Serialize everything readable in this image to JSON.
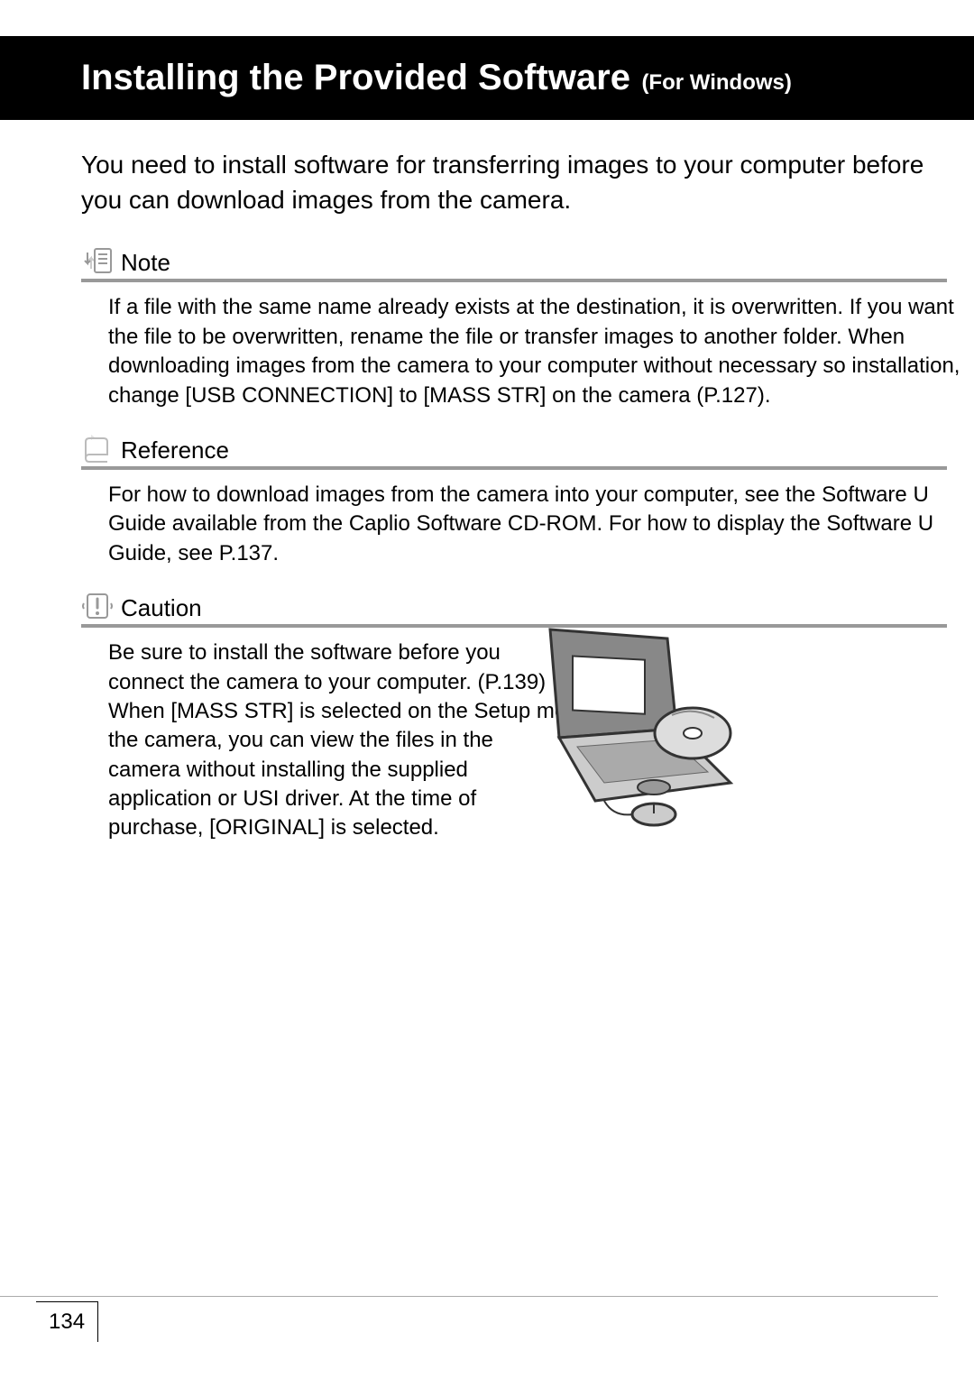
{
  "title": {
    "main": "Installing the Provided Software",
    "sub": "(For Windows)"
  },
  "intro": "You need to install software for transferring images to your computer before you can download images from the camera.",
  "note": {
    "label": "Note",
    "body": "If a file with the same name already exists at the destination, it is overwritten. If you want the file to be overwritten, rename the file or transfer images to another folder. When downloading images from the camera to your computer without necessary so installation, change [USB CONNECTION] to [MASS STR] on the camera (P.127)."
  },
  "reference": {
    "label": "Reference",
    "body": "For how to download images from the camera into your computer, see the Software U Guide available from the Caplio Software CD-ROM. For how to display the Software U Guide, see P.137."
  },
  "caution": {
    "label": "Caution",
    "body": "Be sure to install the software before you connect the camera to your computer. (P.139)\nWhen [MASS STR] is selected on the Setup me the camera, you can view the files in the camera without installing the supplied application or USI driver. At the time of purchase, [ORIGINAL] is selected."
  },
  "page_number": "134"
}
